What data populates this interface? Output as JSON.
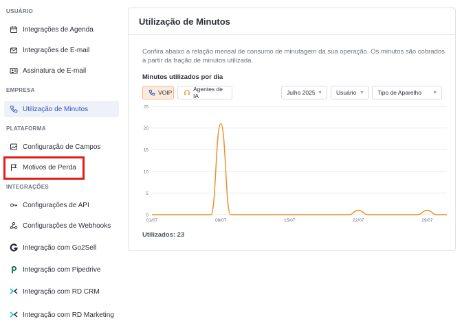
{
  "sidebar": {
    "sections": [
      {
        "title": "USUÁRIO"
      },
      {
        "title": "EMPRESA"
      },
      {
        "title": "PLATAFORMA"
      },
      {
        "title": "INTEGRAÇÕES"
      }
    ],
    "items": [
      {
        "label": "Integrações de Agenda",
        "icon": "calendar-icon"
      },
      {
        "label": "Integrações de E-mail",
        "icon": "mail-icon"
      },
      {
        "label": "Assinatura de E-mail",
        "icon": "id-card-icon"
      },
      {
        "label": "Utilização de Minutos",
        "icon": "phone-icon",
        "active": true
      },
      {
        "label": "Configuração de Campos",
        "icon": "image-frame-icon"
      },
      {
        "label": "Motivos de Perda",
        "icon": "flag-icon"
      },
      {
        "label": "Configurações de API",
        "icon": "key-icon"
      },
      {
        "label": "Configurações de Webhooks",
        "icon": "webhook-icon"
      },
      {
        "label": "Integração com Go2Sell",
        "icon": "go2sell-logo-icon"
      },
      {
        "label": "Integração com Pipedrive",
        "icon": "pipedrive-logo-icon"
      },
      {
        "label": "Integração com RD CRM",
        "icon": "rd-logo-icon"
      },
      {
        "label": "Integração com RD Marketing",
        "icon": "rd-logo-icon"
      }
    ]
  },
  "main": {
    "title": "Utilização de Minutos",
    "description": "Confira abaixo a relação mensal de consumo de minutagem da sua operação. Os minutos são cobrados à partir da fração de minutos utilizada.",
    "chart_subtitle": "Minutos utilizados por dia",
    "buttons": {
      "voip": "VOIP",
      "agents": "Agentes de IA"
    },
    "filters": {
      "month": "Julho 2025",
      "user": "Usuário",
      "device": "Tipo de Aparelho"
    },
    "used_label": "Utilizados: 23"
  },
  "colors": {
    "accent": "#2f55c5",
    "series": "#f28c28",
    "highlight": "#e21b1b"
  },
  "chart_data": {
    "type": "line",
    "x": [
      1,
      2,
      3,
      4,
      5,
      6,
      7,
      8,
      9,
      10,
      11,
      12,
      13,
      14,
      15,
      16,
      17,
      18,
      19,
      20,
      21,
      22,
      23,
      24,
      25,
      26,
      27,
      28,
      29,
      30,
      31
    ],
    "x_tick_labels": [
      "01/07",
      "08/07",
      "15/07",
      "22/07",
      "29/07"
    ],
    "x_tick_days": [
      1,
      8,
      15,
      22,
      29
    ],
    "y_ticks": [
      0,
      5,
      10,
      15,
      20,
      25
    ],
    "ylim": [
      0,
      25
    ],
    "series": [
      {
        "values": [
          0,
          0,
          0,
          0,
          0,
          0,
          0,
          21,
          0,
          0,
          0,
          0,
          0,
          0,
          0,
          0,
          0,
          0,
          0,
          0,
          0,
          1,
          0,
          0,
          0,
          0,
          0,
          0,
          1,
          0,
          0
        ]
      }
    ],
    "grid": true
  }
}
